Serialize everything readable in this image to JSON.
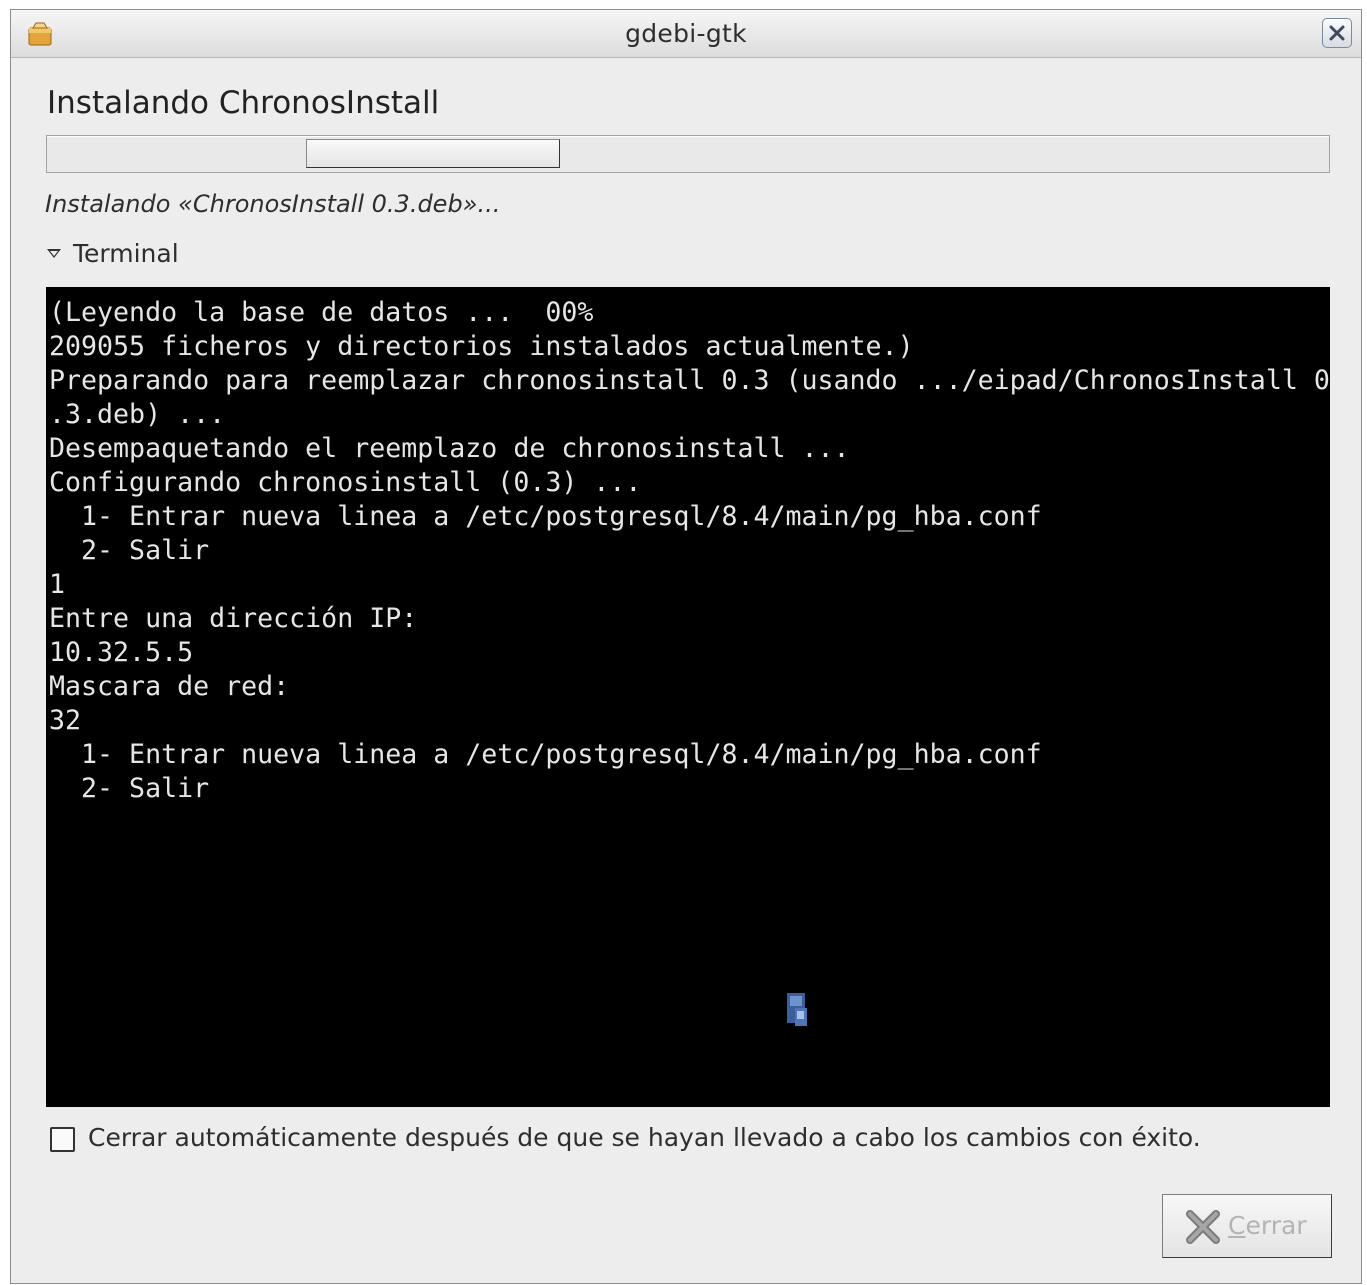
{
  "window": {
    "title": "gdebi-gtk"
  },
  "heading": "Instalando ChronosInstall",
  "status": "Instalando «ChronosInstall 0.3.deb»...",
  "expander": {
    "label": "Terminal",
    "expanded": true
  },
  "progress": {
    "mode": "indeterminate"
  },
  "terminal": {
    "lines": [
      "(Leyendo la base de datos ...  00%",
      "209055 ficheros y directorios instalados actualmente.)",
      "Preparando para reemplazar chronosinstall 0.3 (usando .../eipad/ChronosInstall 0",
      ".3.deb) ...",
      "Desempaquetando el reemplazo de chronosinstall ...",
      "Configurando chronosinstall (0.3) ...",
      "  1- Entrar nueva linea a /etc/postgresql/8.4/main/pg_hba.conf",
      "  2- Salir",
      "1",
      "Entre una dirección IP:",
      "10.32.5.5",
      "Mascara de red:",
      "32",
      "  1- Entrar nueva linea a /etc/postgresql/8.4/main/pg_hba.conf",
      "  2- Salir"
    ]
  },
  "auto_close": {
    "label": "Cerrar automáticamente después de que se hayan llevado a cabo los cambios con éxito.",
    "checked": false
  },
  "close_button": {
    "mnemonic": "C",
    "label_rest": "errar",
    "enabled": false
  },
  "icons": {
    "app": "package-icon",
    "close": "close-icon",
    "button": "x-cross-icon",
    "pointer": "busy-cursor-icon"
  }
}
